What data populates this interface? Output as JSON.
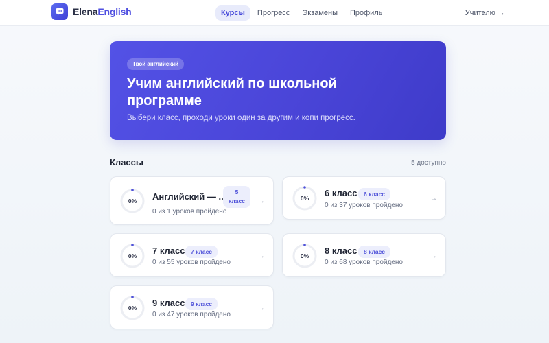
{
  "app": {
    "logo_text_a": "Elena",
    "logo_text_b": "English",
    "accent_color": "#4f4fe0"
  },
  "nav": {
    "items": [
      {
        "label": "Курсы",
        "active": true
      },
      {
        "label": "Прогресс",
        "active": false
      },
      {
        "label": "Экзамены",
        "active": false
      },
      {
        "label": "Профиль",
        "active": false
      }
    ],
    "teacher_link": "Учителю →"
  },
  "hero": {
    "badge": "Твой английский",
    "title": "Учим английский по школьной программе",
    "subtitle": "Выбери класс, проходи уроки один за другим и копи прогресс."
  },
  "section": {
    "title": "Классы",
    "count": "5 доступно"
  },
  "courses": [
    {
      "title": "Английский — ...",
      "badge_line1": "5",
      "badge_line2": "класс",
      "progress_pct": 0,
      "progress_label": "0%",
      "progress_text": "0 из 1 уроков пройдено",
      "arrow": "→"
    },
    {
      "title": "6 класс",
      "badge": "6 класс",
      "progress_pct": 0,
      "progress_label": "0%",
      "progress_text": "0 из 37 уроков пройдено",
      "arrow": "→"
    },
    {
      "title": "7 класс",
      "badge": "7 класс",
      "progress_pct": 0,
      "progress_label": "0%",
      "progress_text": "0 из 55 уроков пройдено",
      "arrow": "→"
    },
    {
      "title": "8 класс",
      "badge": "8 класс",
      "progress_pct": 0,
      "progress_label": "0%",
      "progress_text": "0 из 68 уроков пройдено",
      "arrow": "→"
    },
    {
      "title": "9 класс",
      "badge": "9 класс",
      "progress_pct": 0,
      "progress_label": "0%",
      "progress_text": "0 из 47 уроков пройдено",
      "arrow": "→"
    }
  ]
}
